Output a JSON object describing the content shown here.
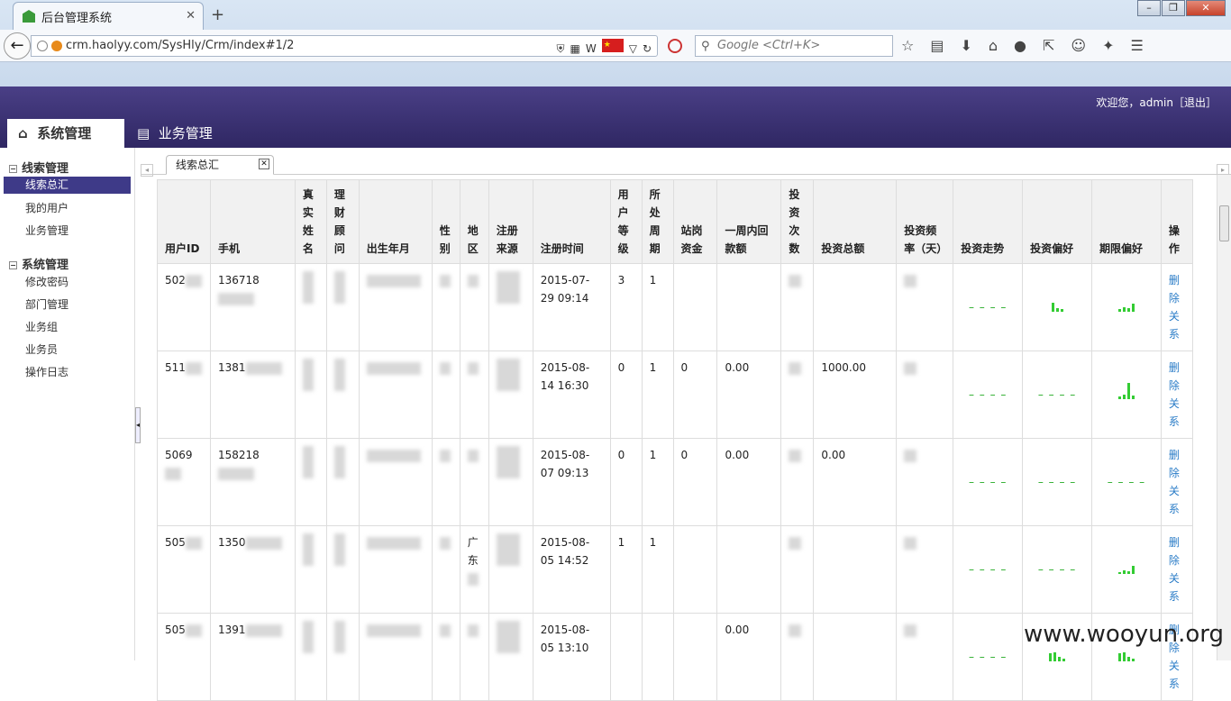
{
  "browser": {
    "tab_title": "后台管理系统",
    "url": "crm.haolyy.com/SysHly/Crm/index#1/2",
    "search_placeholder": "Google <Ctrl+K>"
  },
  "header": {
    "welcome": "欢迎您，admin［退出］",
    "nav_tabs": [
      "系统管理",
      "业务管理"
    ]
  },
  "sidebar": {
    "groups": [
      {
        "title": "线索管理",
        "items": [
          "线索总汇",
          "我的用户",
          "业务管理"
        ]
      },
      {
        "title": "系统管理",
        "items": [
          "修改密码",
          "部门管理",
          "业务组",
          "业务员",
          "操作日志"
        ]
      }
    ],
    "active_item": "线索总汇"
  },
  "content": {
    "tab_label": "线索总汇",
    "columns": [
      "用户ID",
      "手机",
      "真实姓名",
      "理财顾问",
      "出生年月",
      "性别",
      "地区",
      "注册来源",
      "注册时间",
      "用户等级",
      "所处周期",
      "站岗资金",
      "一周内回款额",
      "投资次数",
      "投资总额",
      "投资频率（天）",
      "投资走势",
      "投资偏好",
      "期限偏好",
      "操作"
    ],
    "rows": [
      {
        "id": "502",
        "phone": "136718",
        "reg_time": "2015-07-29 09:14",
        "level": "3",
        "cycle": "1",
        "idle": "",
        "week": "",
        "region": "",
        "total": "",
        "action": "删除关系"
      },
      {
        "id": "511",
        "phone": "1381",
        "reg_time": "2015-08-14 16:30",
        "level": "0",
        "cycle": "1",
        "idle": "0",
        "week": "0.00",
        "region": "",
        "total": "1000.00",
        "action": "删除关系"
      },
      {
        "id": "5069",
        "phone": "158218",
        "reg_time": "2015-08-07 09:13",
        "level": "0",
        "cycle": "1",
        "idle": "0",
        "week": "0.00",
        "region": "",
        "total": "0.00",
        "action": "删除关系"
      },
      {
        "id": "505",
        "phone": "1350",
        "reg_time": "2015-08-05 14:52",
        "level": "1",
        "cycle": "1",
        "idle": "",
        "week": "",
        "region": "广东",
        "total": "",
        "action": "删除关系"
      },
      {
        "id": "505",
        "phone": "1391",
        "reg_time": "2015-08-05 13:10",
        "level": "",
        "cycle": "",
        "idle": "",
        "week": "0.00",
        "region": "",
        "total": "",
        "action": "删除关系"
      }
    ]
  },
  "watermark": "www.wooyun.org"
}
